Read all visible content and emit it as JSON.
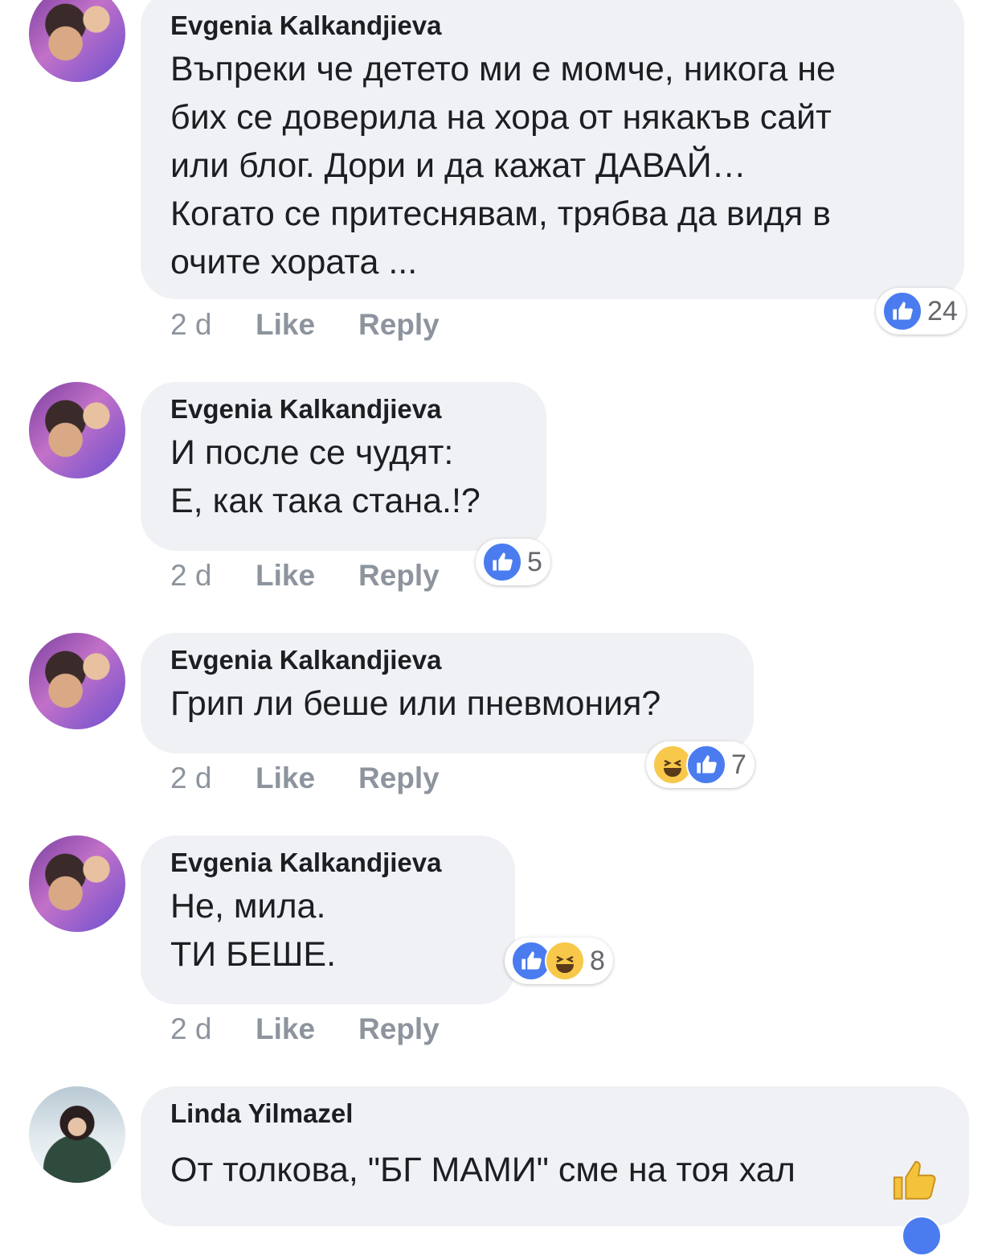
{
  "comments": [
    {
      "author": "Evgenia Kalkandjieva",
      "text": "Въпреки че детето ми е момче, никога не\nбих се доверила на хора от някакъв сайт\nили блог. Дори и да кажат ДАВАЙ…\nКогато се притеснявам, трябва да видя в\nочите хората ...",
      "time": "2 d",
      "like_label": "Like",
      "reply_label": "Reply",
      "reaction_count": "24",
      "reactions": [
        "like"
      ]
    },
    {
      "author": "Evgenia Kalkandjieva",
      "text": "И после се чудят:\nЕ, как така стана.!?",
      "time": "2 d",
      "like_label": "Like",
      "reply_label": "Reply",
      "reaction_count": "5",
      "reactions": [
        "like"
      ]
    },
    {
      "author": "Evgenia Kalkandjieva",
      "text": "Грип ли беше или пневмония?",
      "time": "2 d",
      "like_label": "Like",
      "reply_label": "Reply",
      "reaction_count": "7",
      "reactions": [
        "haha",
        "like"
      ]
    },
    {
      "author": "Evgenia Kalkandjieva",
      "text": "Не, мила.\nТИ БЕШЕ.",
      "time": "2 d",
      "like_label": "Like",
      "reply_label": "Reply",
      "reaction_count": "8",
      "reactions": [
        "like",
        "haha"
      ]
    },
    {
      "author": "Linda Yilmazel",
      "text": "От толкова, \"БГ МАМИ\" сме на тоя хал",
      "emoji": "thumbs-up-icon"
    }
  ],
  "colors": {
    "bubble": "#f0f1f4",
    "like_blue": "#4a7cf0",
    "haha_yellow": "#f7c84a",
    "meta_gray": "#8d949e"
  }
}
